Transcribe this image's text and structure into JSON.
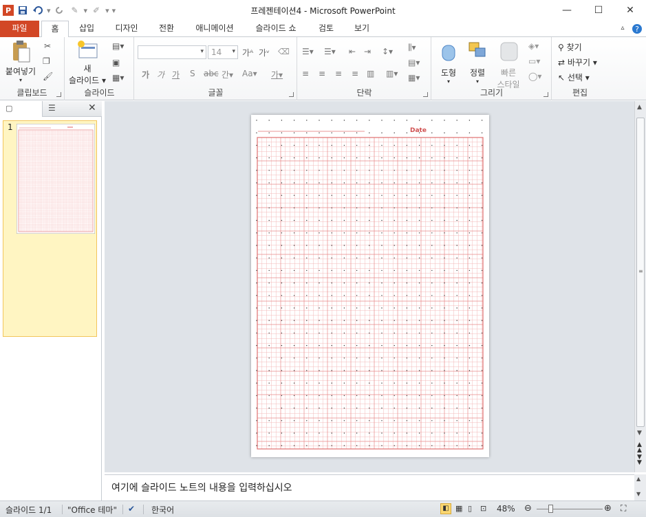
{
  "window": {
    "title": "프레젠테이션4 - Microsoft PowerPoint",
    "minimize": "—",
    "maximize": "☐",
    "close": "✕"
  },
  "qat": {
    "app_icon": "P",
    "more": "▾"
  },
  "tabs": [
    {
      "label": "파일"
    },
    {
      "label": "홈"
    },
    {
      "label": "삽입"
    },
    {
      "label": "디자인"
    },
    {
      "label": "전환"
    },
    {
      "label": "애니메이션"
    },
    {
      "label": "슬라이드 쇼"
    },
    {
      "label": "검토"
    },
    {
      "label": "보기"
    }
  ],
  "ribbon": {
    "clipboard": {
      "group": "클립보드",
      "paste": "붙여넣기"
    },
    "slides": {
      "group": "슬라이드",
      "new_slide_line1": "새",
      "new_slide_line2": "슬라이드"
    },
    "font": {
      "group": "글꼴",
      "font_size": "14"
    },
    "paragraph": {
      "group": "단락"
    },
    "drawing": {
      "group": "그리기",
      "shapes": "도형",
      "arrange": "정렬",
      "quick_styles_line1": "빠른",
      "quick_styles_line2": "스타일"
    },
    "editing": {
      "group": "편집",
      "find": "찾기",
      "replace": "바꾸기",
      "select": "선택"
    }
  },
  "thumbnails": [
    {
      "number": "1"
    }
  ],
  "slide": {
    "date_label": "Date"
  },
  "notes": {
    "placeholder": "여기에 슬라이드 노트의 내용을 입력하십시오"
  },
  "status": {
    "slide_count": "슬라이드 1/1",
    "theme": "\"Office 테마\"",
    "language": "한국어",
    "zoom": "48%"
  },
  "colors": {
    "file_tab": "#d24726",
    "grid": "#e06060",
    "accent": "#2b579a"
  }
}
